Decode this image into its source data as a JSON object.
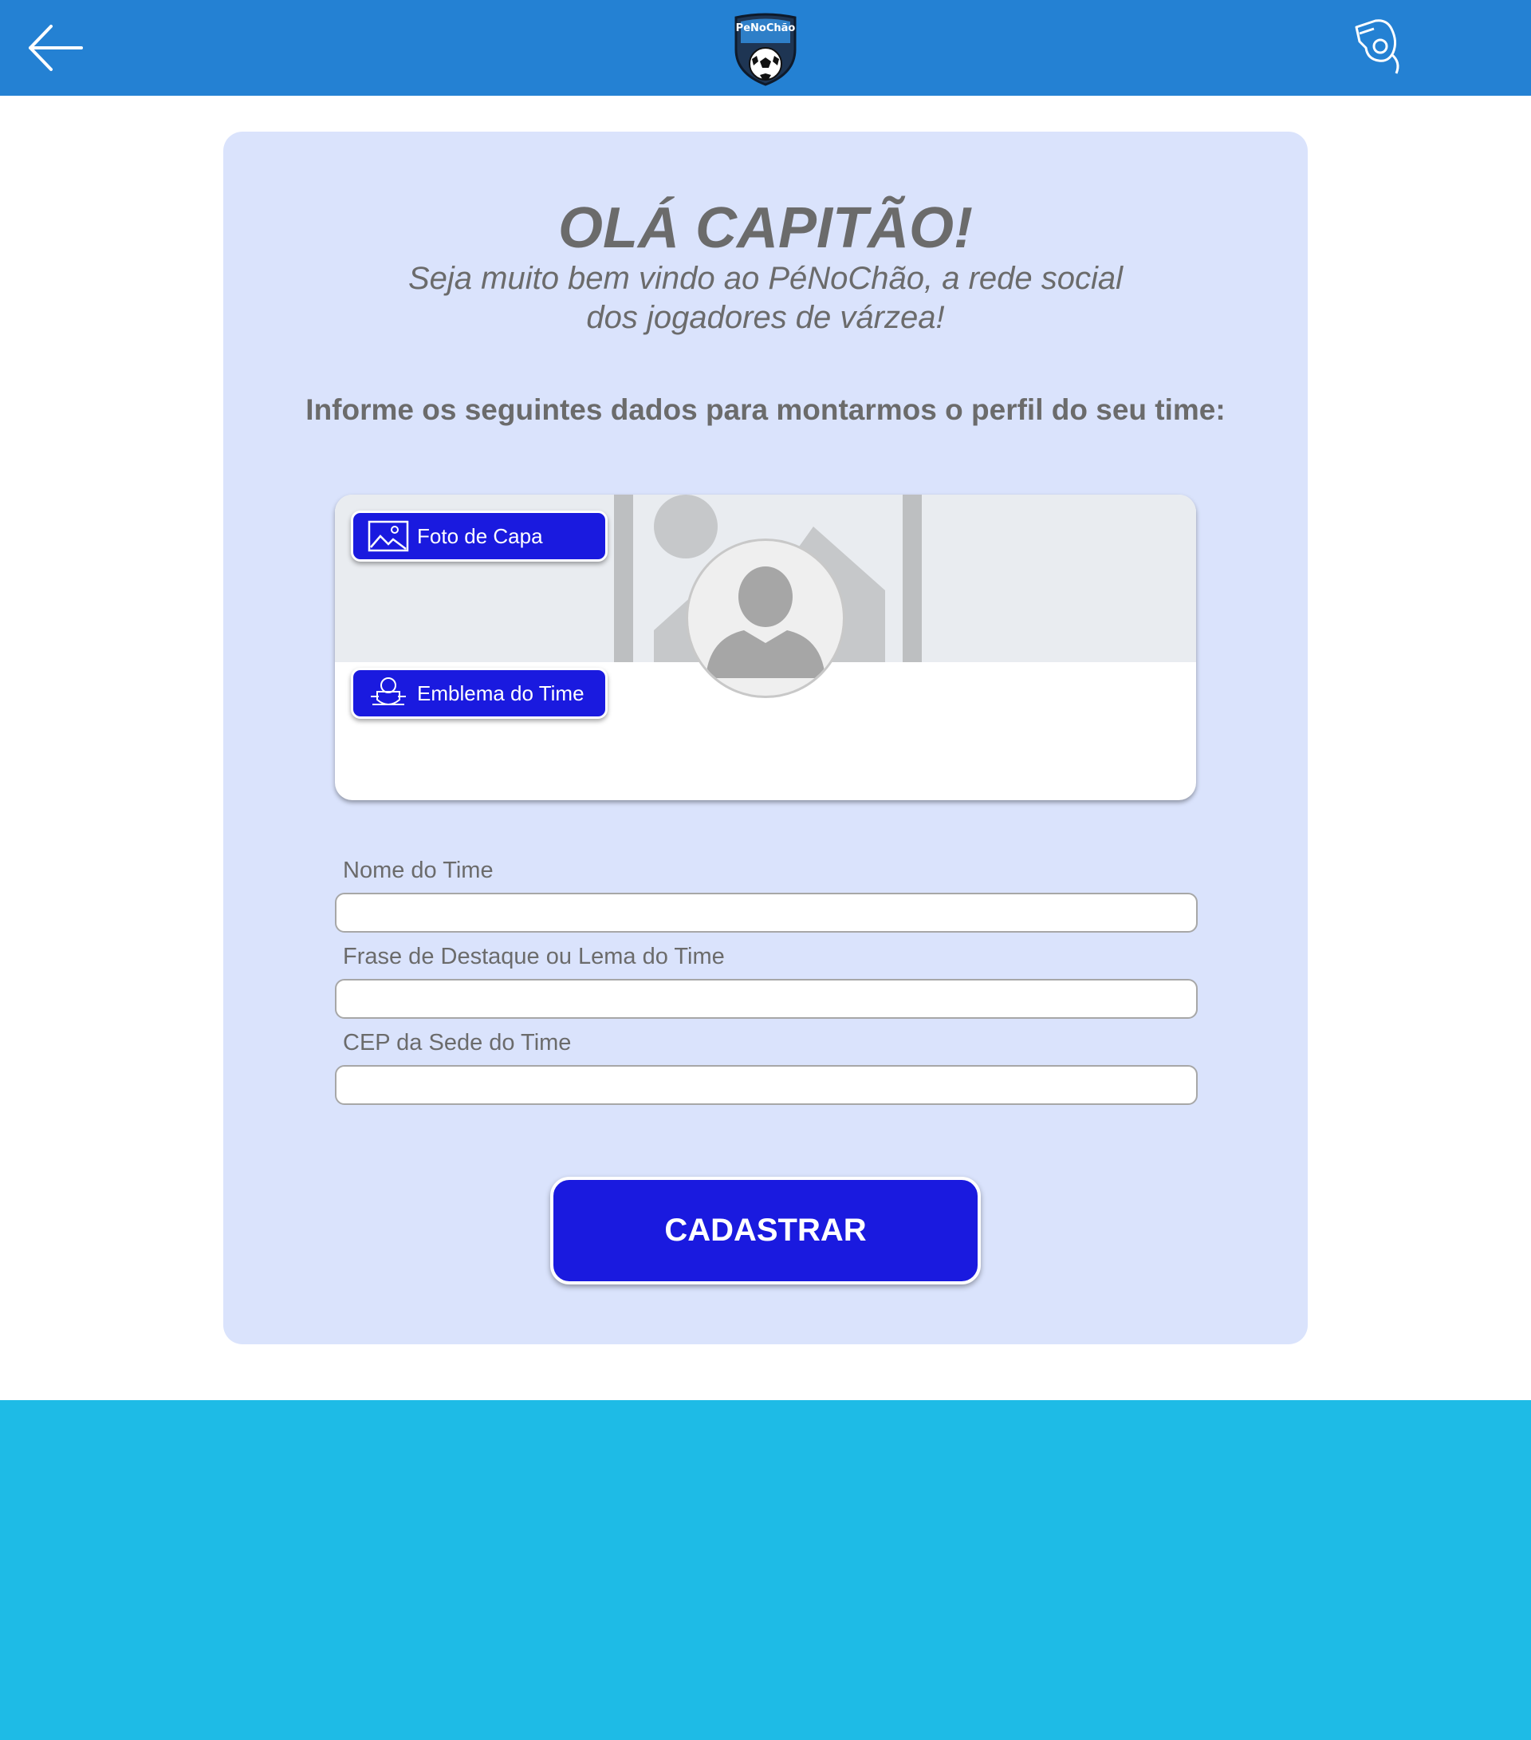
{
  "header": {
    "logo_text": "PeNoChão",
    "back_icon": "arrow-left-icon",
    "whistle_icon": "whistle-icon",
    "bar_color": "#2481d3"
  },
  "card": {
    "title": "OLÁ CAPITÃO!",
    "subtitle_line1": "Seja muito bem vindo ao PéNoChão, a rede social",
    "subtitle_line2": "dos jogadores de várzea!",
    "instructions": "Informe os seguintes dados para montarmos o perfil do seu time:",
    "background_color": "#dae3fc"
  },
  "profile": {
    "cover_button_label": "Foto de Capa",
    "cover_button_icon": "landscape-image-icon",
    "emblem_button_label": "Emblema do Time",
    "emblem_button_icon": "team-crest-icon",
    "avatar_icon": "user-silhouette-icon",
    "cover_placeholder_icon": "image-placeholder-icon"
  },
  "form": {
    "team_name_label": "Nome do Time",
    "team_name_value": "",
    "motto_label": "Frase de Destaque ou Lema do Time",
    "motto_value": "",
    "cep_label": "CEP da Sede do Time",
    "cep_value": "",
    "submit_label": "CADASTRAR",
    "button_color": "#1a1adf"
  },
  "footer": {
    "color": "#1ebbe6"
  }
}
